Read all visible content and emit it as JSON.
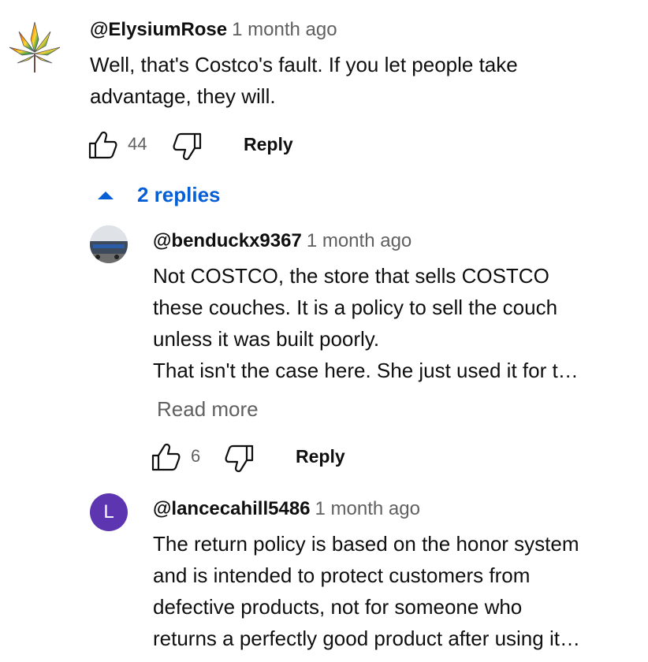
{
  "comment": {
    "author": "@ElysiumRose",
    "time": "1 month ago",
    "lines": [
      "Well, that's Costco's fault. If you let people take",
      "advantage, they will."
    ],
    "likes": "44",
    "reply_label": "Reply"
  },
  "replies_toggle": {
    "label": "2 replies"
  },
  "replies": [
    {
      "author": "@benduckx9367",
      "time": "1 month ago",
      "lines": [
        "Not COSTCO, the store that sells COSTCO",
        "these couches. It is a policy to sell the couch",
        "unless it was built poorly.",
        "That isn't the case here. She just used it for t…"
      ],
      "read_more": "Read more",
      "likes": "6",
      "reply_label": "Reply"
    },
    {
      "author": "@lancecahill5486",
      "time": "1 month ago",
      "avatar_letter": "L",
      "avatar_color": "#5e35b1",
      "lines": [
        "The return policy is based on the honor system",
        "and is intended to protect customers from",
        "defective products, not for someone who",
        "returns a perfectly good product after using it…"
      ]
    }
  ]
}
